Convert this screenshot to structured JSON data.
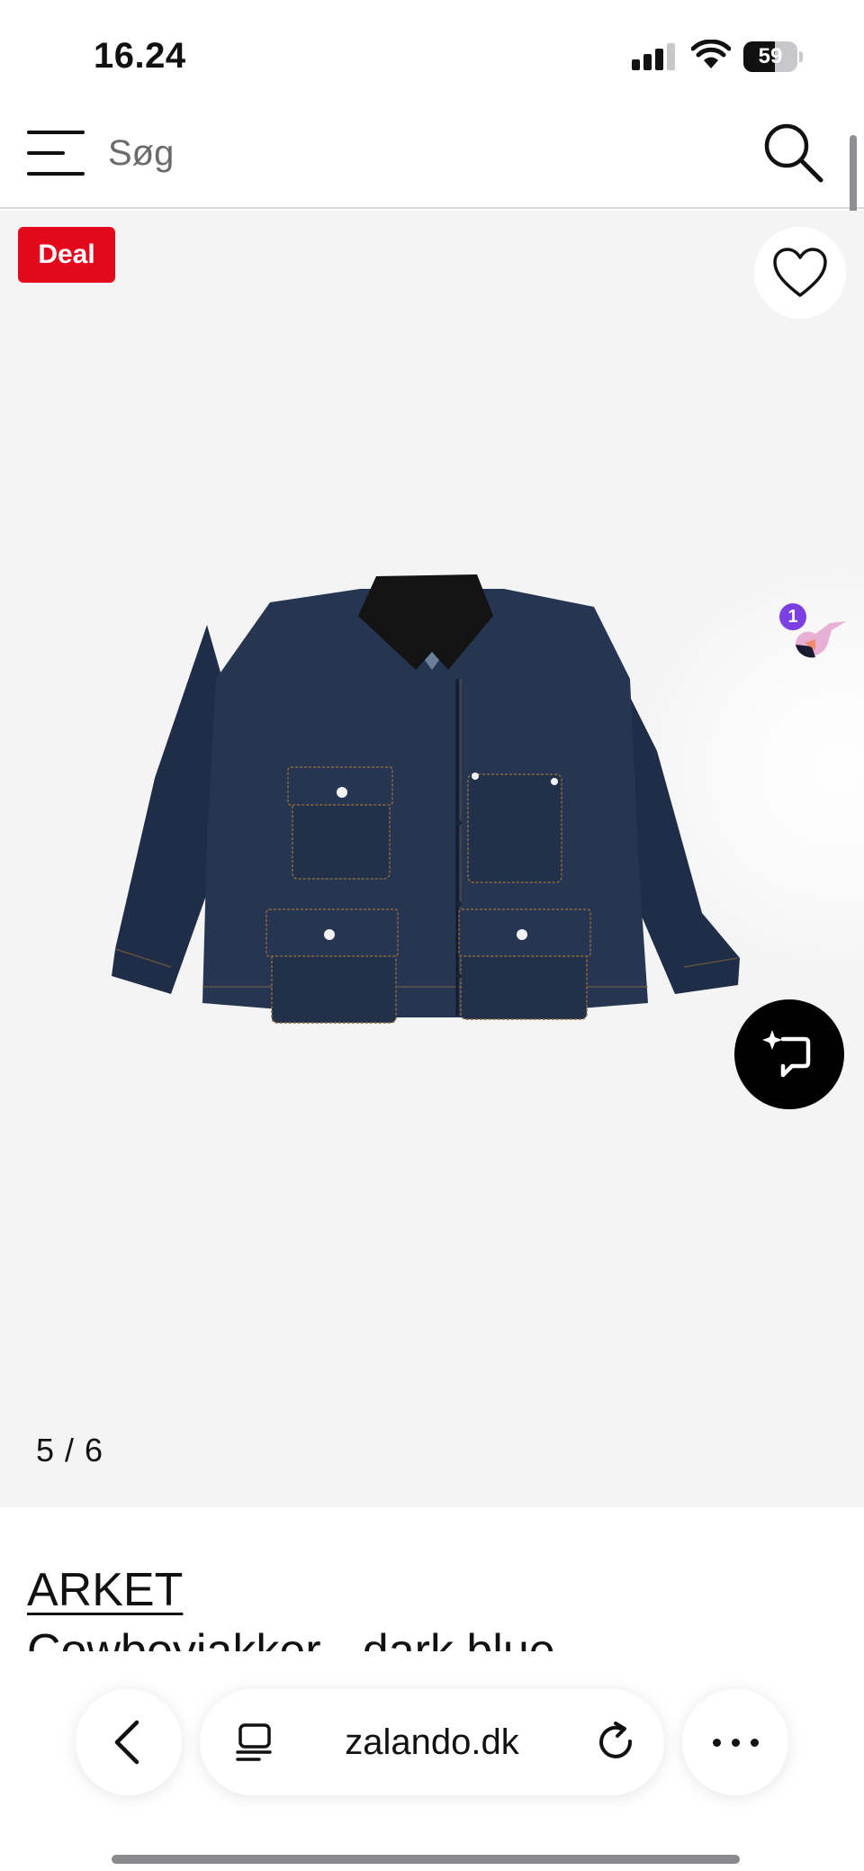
{
  "status_bar": {
    "time": "16.24",
    "battery_level": "59",
    "signal_bars_active": 3,
    "signal_bars_total": 4
  },
  "header": {
    "menu_icon": "hamburger-menu-icon",
    "search_placeholder": "Søg",
    "search_icon": "search-icon"
  },
  "gallery": {
    "deal_badge": "Deal",
    "wishlist_icon": "heart-icon",
    "assistant_notification_count": "1",
    "image_counter": "5 / 6",
    "image_alt": "ARKET Cowboyjakker - dark blue",
    "ai_button_icon": "sparkle-chat-icon"
  },
  "product": {
    "brand": "ARKET",
    "name": "Cowboyjakker - dark blue"
  },
  "browser_bar": {
    "back_icon": "chevron-left-icon",
    "reader_icon": "reader-mode-icon",
    "url": "zalando.dk",
    "reload_icon": "reload-icon",
    "more_icon": "more-dots-icon"
  },
  "colors": {
    "deal_red": "#e3081b",
    "gallery_bg": "#f4f4f5",
    "denim": "#253552",
    "collar": "#151515",
    "assistant_purple": "#7b3fe4"
  }
}
